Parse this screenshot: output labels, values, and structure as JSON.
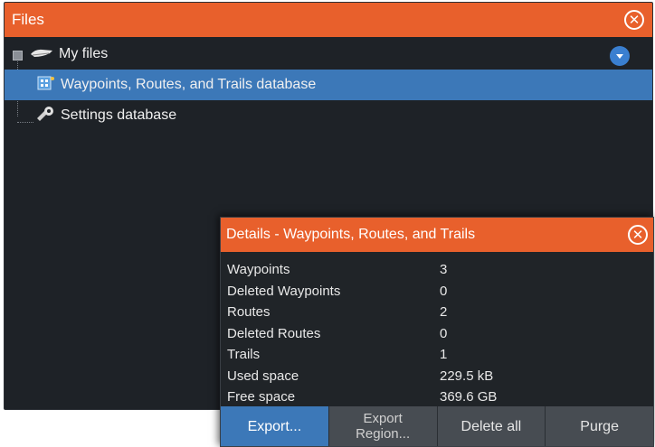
{
  "window": {
    "title": "Files",
    "close_glyph": "✕"
  },
  "tree": {
    "items": [
      {
        "label": "My files",
        "icon": "folder-icon"
      },
      {
        "label": "Waypoints, Routes, and Trails database",
        "icon": "database-icon",
        "selected": true
      },
      {
        "label": "Settings database",
        "icon": "settings-icon"
      }
    ]
  },
  "dialog": {
    "title": "Details - Waypoints, Routes, and Trails",
    "close_glyph": "✕",
    "details": [
      {
        "label": "Waypoints",
        "value": "3"
      },
      {
        "label": "Deleted Waypoints",
        "value": "0"
      },
      {
        "label": "Routes",
        "value": "2"
      },
      {
        "label": "Deleted Routes",
        "value": "0"
      },
      {
        "label": "Trails",
        "value": "1"
      },
      {
        "label": "Used space",
        "value": "229.5 kB"
      },
      {
        "label": "Free space",
        "value": "369.6 GB"
      }
    ],
    "buttons": {
      "export": "Export...",
      "export_region_line1": "Export",
      "export_region_line2": "Region...",
      "delete_all": "Delete all",
      "purge": "Purge"
    }
  },
  "colors": {
    "title_bar": "#e8602c",
    "selection": "#3c78b8",
    "background": "#1e2227"
  }
}
